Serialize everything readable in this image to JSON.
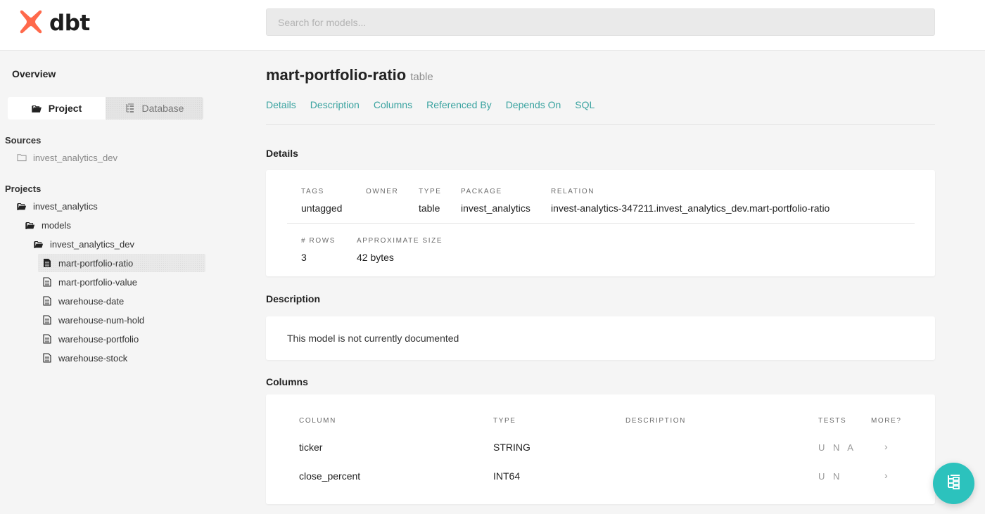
{
  "brand": {
    "name": "dbt",
    "color": "#ff694b"
  },
  "search": {
    "placeholder": "Search for models..."
  },
  "sidebar": {
    "overview": "Overview",
    "switcher": {
      "project": "Project",
      "database": "Database"
    },
    "sources_label": "Sources",
    "sources": [
      {
        "label": "invest_analytics_dev",
        "icon": "folder-outline-icon"
      }
    ],
    "projects_label": "Projects",
    "tree": {
      "project": "invest_analytics",
      "models": "models",
      "schema": "invest_analytics_dev",
      "files": [
        "mart-portfolio-ratio",
        "mart-portfolio-value",
        "warehouse-date",
        "warehouse-num-hold",
        "warehouse-portfolio",
        "warehouse-stock"
      ],
      "selected": "mart-portfolio-ratio"
    }
  },
  "model": {
    "name": "mart-portfolio-ratio",
    "materialization": "table"
  },
  "tabs": [
    "Details",
    "Description",
    "Columns",
    "Referenced By",
    "Depends On",
    "SQL"
  ],
  "details": {
    "heading": "Details",
    "tags_label": "TAGS",
    "tags": "untagged",
    "owner_label": "OWNER",
    "owner": "",
    "type_label": "TYPE",
    "type": "table",
    "package_label": "PACKAGE",
    "package": "invest_analytics",
    "relation_label": "RELATION",
    "relation": "invest-analytics-347211.invest_analytics_dev.mart-portfolio-ratio",
    "rows_label": "# ROWS",
    "rows": "3",
    "size_label": "APPROXIMATE SIZE",
    "size": "42 bytes"
  },
  "description": {
    "heading": "Description",
    "text": "This model is not currently documented"
  },
  "columns": {
    "heading": "Columns",
    "headers": {
      "column": "COLUMN",
      "type": "TYPE",
      "description": "DESCRIPTION",
      "tests": "TESTS",
      "more": "MORE?"
    },
    "rows": [
      {
        "column": "ticker",
        "type": "STRING",
        "description": "",
        "tests": "U N A",
        "more": "›"
      },
      {
        "column": "close_percent",
        "type": "INT64",
        "description": "",
        "tests": "U N",
        "more": "›"
      }
    ]
  },
  "accent": {
    "link": "#3aa3a0",
    "fab": "#2cc2bd"
  }
}
